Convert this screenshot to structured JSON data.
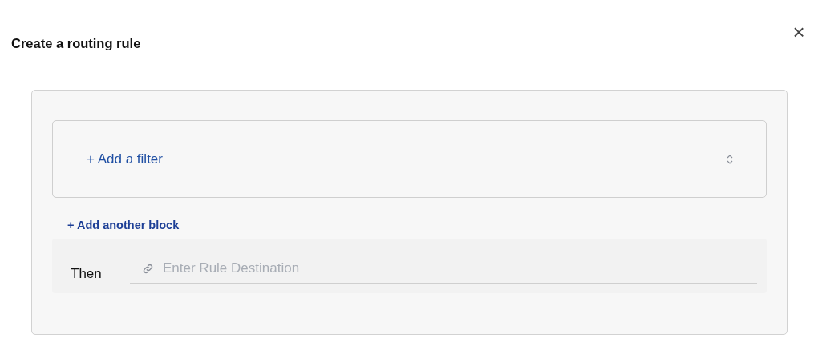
{
  "dialog": {
    "title": "Create a routing rule",
    "close": "×"
  },
  "filter_block": {
    "add_filter": "+ Add a filter"
  },
  "add_block": "+ Add another block",
  "then_row": {
    "label": "Then",
    "destination": {
      "placeholder": "Enter Rule Destination"
    }
  }
}
